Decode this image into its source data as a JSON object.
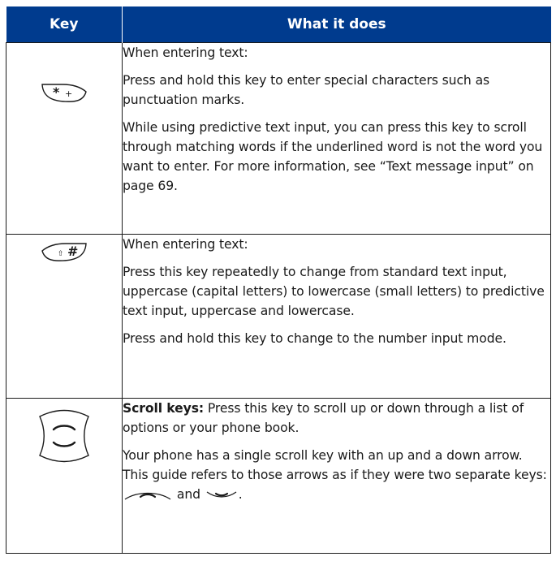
{
  "table": {
    "headers": {
      "key": "Key",
      "what": "What it does"
    },
    "rows": [
      {
        "key_icon": "star-plus-key-icon",
        "paragraphs": [
          "When entering text:",
          "Press and hold this key to enter special characters such as punctuation marks.",
          "While using predictive text input, you can press this key to scroll through matching words if the underlined word is not the word you want to enter. For more information, see “Text message input” on page 69."
        ]
      },
      {
        "key_icon": "shift-hash-key-icon",
        "paragraphs": [
          "When entering text:",
          "Press this key repeatedly to change from standard text input, uppercase (capital letters) to lowercase (small letters) to predictive text input, uppercase and lowercase.",
          "Press and hold this key to change to the number input mode."
        ]
      },
      {
        "key_icon": "scroll-key-icon",
        "scroll_label": "Scroll keys:",
        "scroll_text": " Press this key to scroll up or down through a list of options or your phone book.",
        "para2_before": "Your phone has a single scroll key with an up and a down arrow. This guide refers to those arrows as if they were two separate keys: ",
        "para2_and": " and ",
        "para2_end": ".",
        "up_icon": "scroll-up-icon",
        "down_icon": "scroll-down-icon"
      }
    ]
  }
}
